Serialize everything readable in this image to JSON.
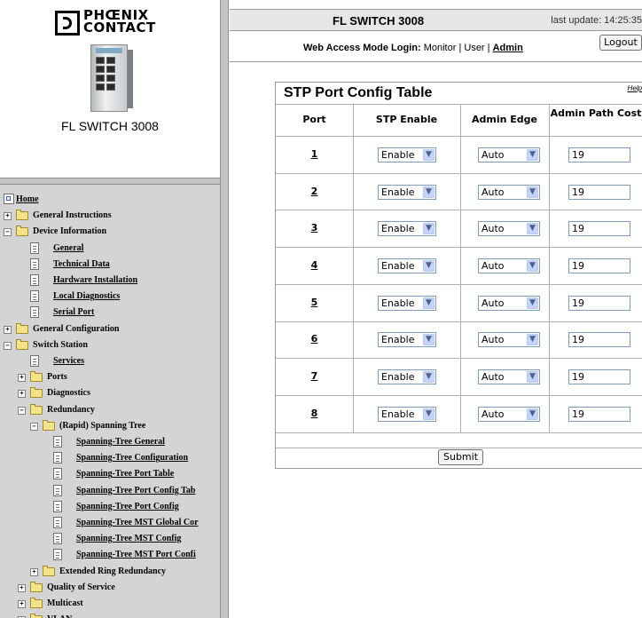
{
  "brand": {
    "logo_text": "PHOENIX\nCONTACT",
    "device_name": "FL SWITCH 3008"
  },
  "header": {
    "title": "FL SWITCH 3008",
    "last_update": "last update: 14:25:35",
    "login_label": "Web Access Mode Login:",
    "mode_monitor": "Monitor",
    "sep1": " | ",
    "mode_user": "User",
    "sep2": " | ",
    "mode_admin": "Admin",
    "logout": "Logout"
  },
  "nav": [
    {
      "label": "Home",
      "depth": 0,
      "type": "home",
      "link": true
    },
    {
      "label": "General Instructions",
      "depth": 0,
      "type": "folder",
      "state": "closed"
    },
    {
      "label": "Device Information",
      "depth": 0,
      "type": "folder",
      "state": "open"
    },
    {
      "label": "General",
      "depth": 1,
      "type": "page",
      "link": true
    },
    {
      "label": "Technical Data",
      "depth": 1,
      "type": "page",
      "link": true
    },
    {
      "label": "Hardware Installation",
      "depth": 1,
      "type": "page",
      "link": true
    },
    {
      "label": "Local Diagnostics",
      "depth": 1,
      "type": "page",
      "link": true
    },
    {
      "label": "Serial Port",
      "depth": 1,
      "type": "page",
      "link": true
    },
    {
      "label": "General Configuration",
      "depth": 0,
      "type": "folder",
      "state": "closed"
    },
    {
      "label": "Switch Station",
      "depth": 0,
      "type": "folder",
      "state": "open"
    },
    {
      "label": "Services",
      "depth": 1,
      "type": "page",
      "link": true
    },
    {
      "label": "Ports",
      "depth": 1,
      "type": "folder",
      "state": "closed"
    },
    {
      "label": "Diagnostics",
      "depth": 1,
      "type": "folder",
      "state": "closed"
    },
    {
      "label": "Redundancy",
      "depth": 1,
      "type": "folder",
      "state": "open"
    },
    {
      "label": "(Rapid) Spanning Tree",
      "depth": 2,
      "type": "folder",
      "state": "open"
    },
    {
      "label": "Spanning-Tree General",
      "depth": 3,
      "type": "page",
      "link": true
    },
    {
      "label": "Spanning-Tree Configuration",
      "depth": 3,
      "type": "page",
      "link": true
    },
    {
      "label": "Spanning-Tree Port Table",
      "depth": 3,
      "type": "page",
      "link": true
    },
    {
      "label": "Spanning-Tree Port Config Tab",
      "depth": 3,
      "type": "page",
      "link": true
    },
    {
      "label": "Spanning-Tree Port Config",
      "depth": 3,
      "type": "page",
      "link": true
    },
    {
      "label": "Spanning-Tree MST Global Cor",
      "depth": 3,
      "type": "page",
      "link": true
    },
    {
      "label": "Spanning-Tree MST Config",
      "depth": 3,
      "type": "page",
      "link": true
    },
    {
      "label": "Spanning-Tree MST Port Confi",
      "depth": 3,
      "type": "page",
      "link": true
    },
    {
      "label": "Extended Ring Redundancy",
      "depth": 2,
      "type": "folder",
      "state": "closed"
    },
    {
      "label": "Quality of Service",
      "depth": 1,
      "type": "folder",
      "state": "closed"
    },
    {
      "label": "Multicast",
      "depth": 1,
      "type": "folder",
      "state": "closed"
    },
    {
      "label": "VLAN",
      "depth": 1,
      "type": "folder",
      "state": "closed"
    }
  ],
  "table": {
    "title": "STP Port Config Table",
    "help": "Help",
    "columns": [
      "Port",
      "STP Enable",
      "Admin Edge",
      "Admin Path Cost"
    ],
    "rows": [
      {
        "port": "1",
        "stp_enable": "Enable",
        "admin_edge": "Auto",
        "path_cost": "19"
      },
      {
        "port": "2",
        "stp_enable": "Enable",
        "admin_edge": "Auto",
        "path_cost": "19"
      },
      {
        "port": "3",
        "stp_enable": "Enable",
        "admin_edge": "Auto",
        "path_cost": "19"
      },
      {
        "port": "4",
        "stp_enable": "Enable",
        "admin_edge": "Auto",
        "path_cost": "19"
      },
      {
        "port": "5",
        "stp_enable": "Enable",
        "admin_edge": "Auto",
        "path_cost": "19"
      },
      {
        "port": "6",
        "stp_enable": "Enable",
        "admin_edge": "Auto",
        "path_cost": "19"
      },
      {
        "port": "7",
        "stp_enable": "Enable",
        "admin_edge": "Auto",
        "path_cost": "19"
      },
      {
        "port": "8",
        "stp_enable": "Enable",
        "admin_edge": "Auto",
        "path_cost": "19"
      }
    ],
    "submit": "Submit"
  }
}
